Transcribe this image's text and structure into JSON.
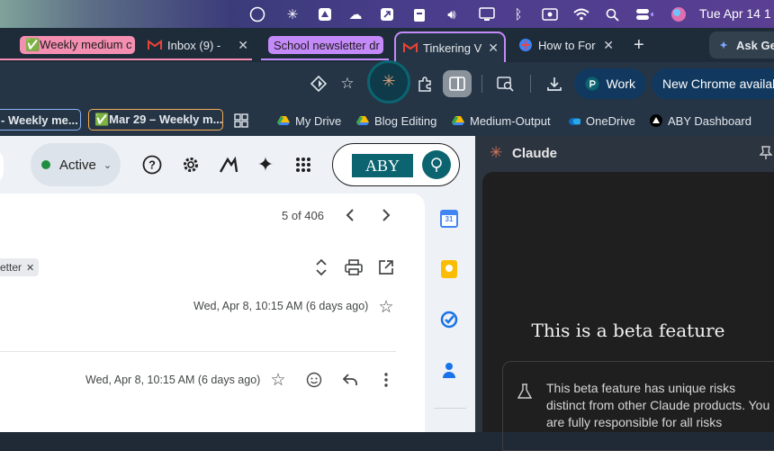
{
  "menubar": {
    "clock": "Tue Apr 14  1"
  },
  "tabs": {
    "group1_label": "✅Weekly medium c",
    "inbox_label": "Inbox (9) -",
    "group2_label": "School newsletter dr",
    "active_label": "Tinkering V",
    "howto_label": "How to For",
    "new_tab": "+",
    "ask_label": "Ask Ge"
  },
  "toolbar": {
    "work_label": "Work",
    "update_label": "New Chrome availab"
  },
  "bookmarks": {
    "item1": "- Weekly me...",
    "item2": "✅Mar 29 – Weekly m...",
    "items": [
      "My Drive",
      "Blog Editing",
      "Medium-Output",
      "OneDrive",
      "ABY Dashboard"
    ]
  },
  "gmail": {
    "status_label": "Active",
    "logo_text": "ABY",
    "pagination": "5 of 406",
    "chip_label": "etter",
    "date1": "Wed, Apr 8, 10:15 AM (6 days ago)",
    "date2": "Wed, Apr 8, 10:15 AM (6 days ago)"
  },
  "claude": {
    "title": "Claude",
    "heading": "This is a beta feature",
    "notice": "This beta feature has unique risks distinct from other Claude products. You are fully responsible for all risks"
  },
  "colors": {
    "group_pink": "#f48fb1",
    "group_purple": "#c58af9",
    "active_tab": "#253545",
    "accent_teal": "#0b6470"
  }
}
